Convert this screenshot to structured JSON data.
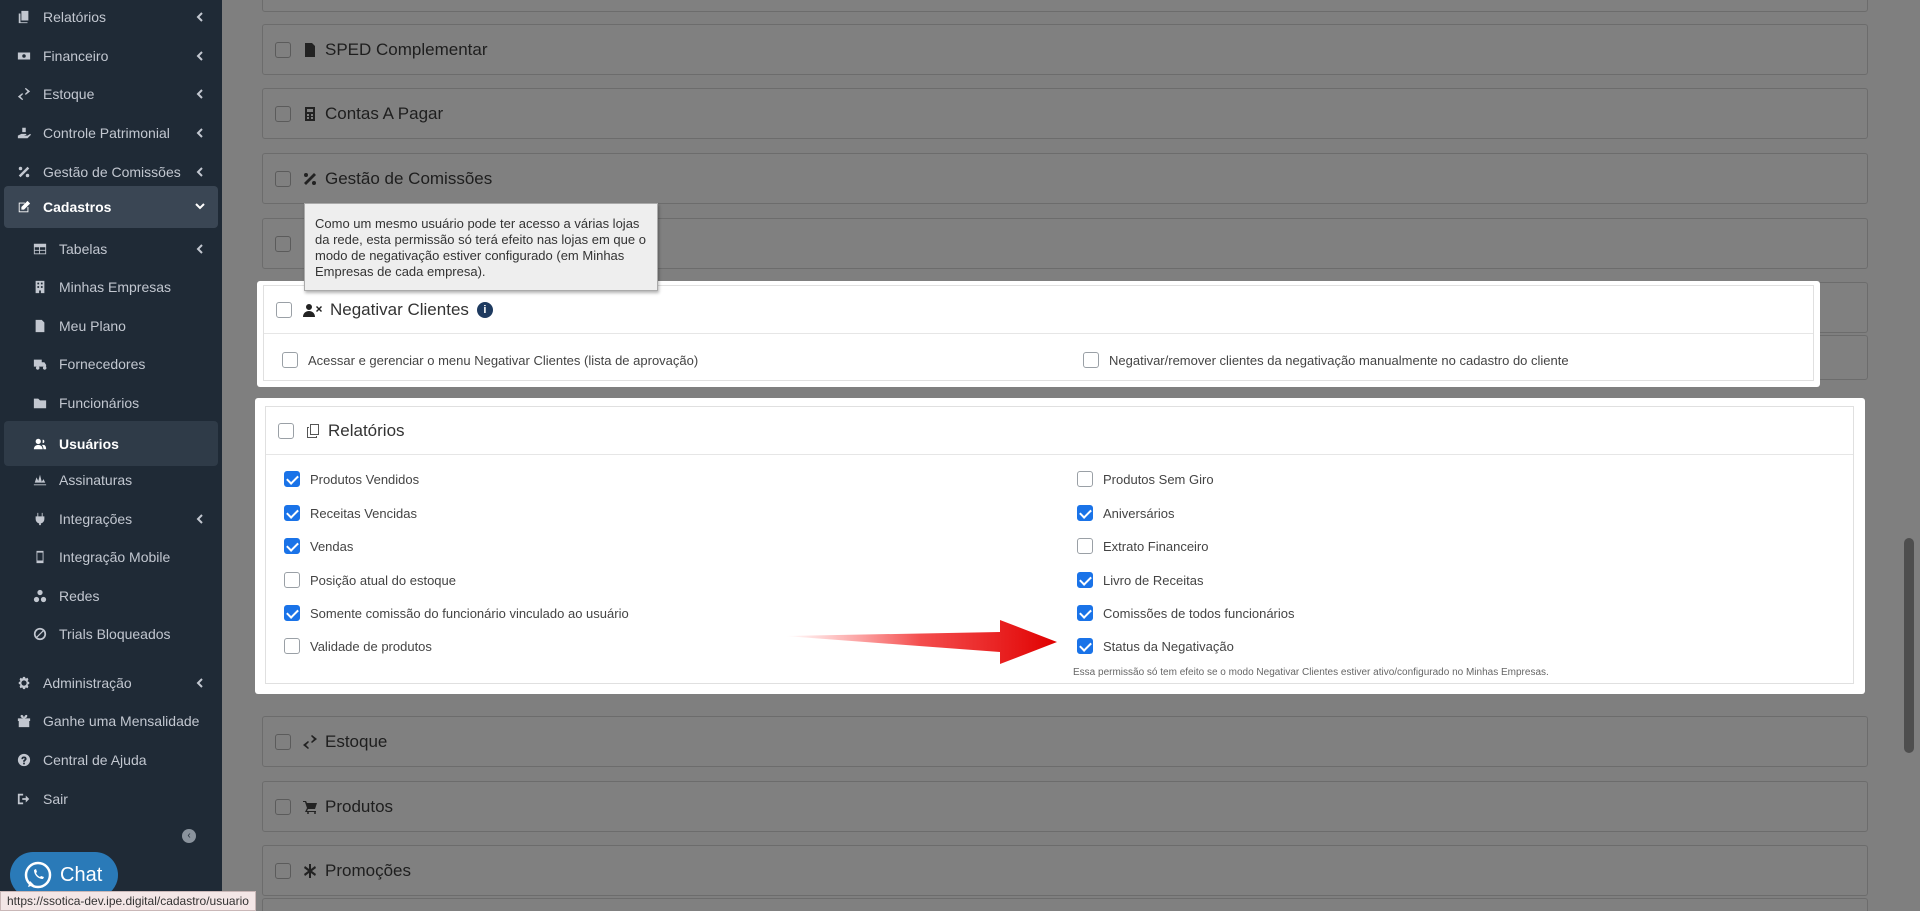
{
  "sidebar": {
    "items": [
      {
        "label": "Relatórios",
        "icon": "copy-icon",
        "chevron": "left"
      },
      {
        "label": "Financeiro",
        "icon": "money-icon",
        "chevron": "left"
      },
      {
        "label": "Estoque",
        "icon": "exchange-icon",
        "chevron": "left"
      },
      {
        "label": "Controle Patrimonial",
        "icon": "hand-holding-icon",
        "chevron": "left"
      },
      {
        "label": "Gestão de Comissões",
        "icon": "percent-icon",
        "chevron": "left"
      },
      {
        "label": "Cadastros",
        "icon": "edit-icon",
        "chevron": "down"
      },
      {
        "label": "Tabelas",
        "icon": "table-icon",
        "chevron": "left"
      },
      {
        "label": "Minhas Empresas",
        "icon": "building-icon"
      },
      {
        "label": "Meu Plano",
        "icon": "file-icon"
      },
      {
        "label": "Fornecedores",
        "icon": "truck-icon"
      },
      {
        "label": "Funcionários",
        "icon": "folder-icon"
      },
      {
        "label": "Usuários",
        "icon": "users-icon"
      },
      {
        "label": "Assinaturas",
        "icon": "signature-icon"
      },
      {
        "label": "Integrações",
        "icon": "plug-icon",
        "chevron": "left"
      },
      {
        "label": "Integração Mobile",
        "icon": "mobile-icon"
      },
      {
        "label": "Redes",
        "icon": "network-icon"
      },
      {
        "label": "Trials Bloqueados",
        "icon": "ban-icon"
      },
      {
        "label": "Administração",
        "icon": "gear-icon",
        "chevron": "left"
      },
      {
        "label": "Ganhe uma Mensalidade",
        "icon": "gift-icon"
      },
      {
        "label": "Central de Ajuda",
        "icon": "question-icon"
      },
      {
        "label": "Sair",
        "icon": "sign-out-icon"
      }
    ],
    "chat_label": "Chat"
  },
  "status_url": "https://ssotica-dev.ipe.digital/cadastro/usuario",
  "cards": {
    "sped": "SPED Complementar",
    "contas": "Contas A Pagar",
    "comissoes": "Gestão de Comissões",
    "estoque": "Estoque",
    "produtos": "Produtos",
    "promocoes": "Promoções"
  },
  "tooltip": "Como um mesmo usuário pode ter acesso a várias lojas da rede, esta permissão só terá efeito nas lojas em que o modo de negativação estiver configurado (em Minhas Empresas de cada empresa).",
  "negativar": {
    "title": "Negativar Clientes",
    "info": "i",
    "perms": [
      {
        "label": "Acessar e gerenciar o menu Negativar Clientes (lista de aprovação)",
        "checked": false
      },
      {
        "label": "Negativar/remover clientes da negativação manualmente no cadastro do cliente",
        "checked": false
      }
    ]
  },
  "relatorios": {
    "title": "Relatórios",
    "left": [
      {
        "label": "Produtos Vendidos",
        "checked": true
      },
      {
        "label": "Receitas Vencidas",
        "checked": true
      },
      {
        "label": "Vendas",
        "checked": true
      },
      {
        "label": "Posição atual do estoque",
        "checked": false
      },
      {
        "label": "Somente comissão do funcionário vinculado ao usuário",
        "checked": true
      },
      {
        "label": "Validade de produtos",
        "checked": false
      }
    ],
    "right": [
      {
        "label": "Produtos Sem Giro",
        "checked": false
      },
      {
        "label": "Aniversários",
        "checked": true
      },
      {
        "label": "Extrato Financeiro",
        "checked": false
      },
      {
        "label": "Livro de Receitas",
        "checked": true
      },
      {
        "label": "Comissões de todos funcionários",
        "checked": true
      },
      {
        "label": "Status da Negativação",
        "checked": true
      }
    ],
    "note": "Essa permissão só tem efeito se o modo Negativar Clientes estiver ativo/configurado no Minhas Empresas."
  }
}
